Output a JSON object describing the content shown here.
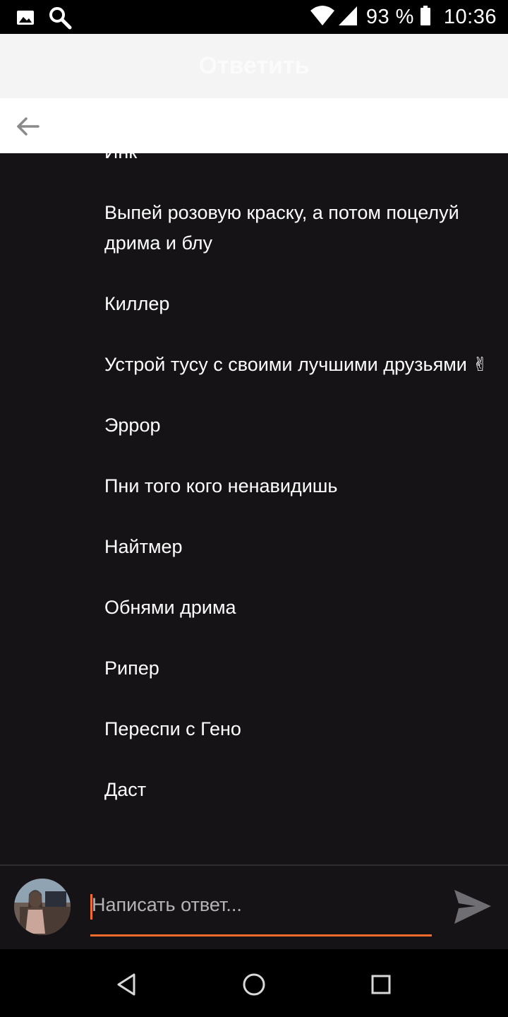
{
  "status_bar": {
    "battery_percent": "93 %",
    "time": "10:36",
    "icons": [
      "image-icon",
      "search-icon",
      "wifi-icon",
      "signal-icon",
      "battery-icon"
    ]
  },
  "header": {
    "title": "Ответить",
    "back_icon": "arrow-left-icon"
  },
  "list": {
    "items": [
      "Инк",
      "Выпей розовую краску, а потом поцелуй дрима и блу",
      "Киллер",
      "Устрой тусу с своими лучшими друзьями ✌",
      "Эррор",
      "Пни того кого ненавидишь",
      "Найтмер",
      "Обнями дрима",
      "Рипер",
      "Переспи с Гено",
      "Даст"
    ]
  },
  "reply": {
    "placeholder": "Написать ответ...",
    "value": "",
    "send_icon": "send-icon",
    "accent_color": "#f36b2c"
  },
  "nav": {
    "icons": [
      "back-triangle-icon",
      "home-circle-icon",
      "recents-square-icon"
    ]
  }
}
